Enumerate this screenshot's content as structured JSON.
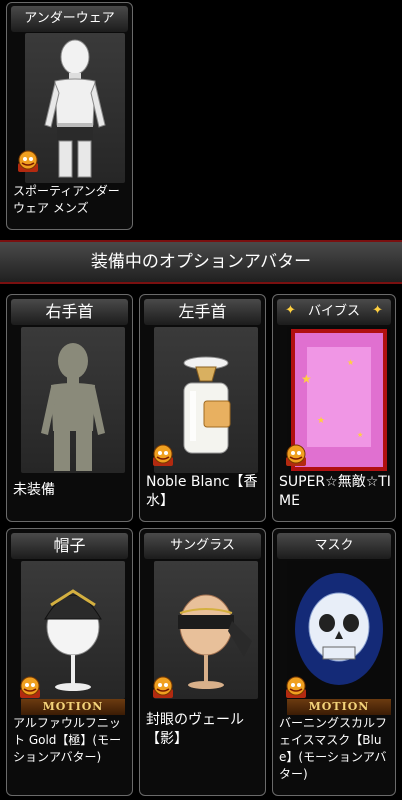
{
  "top_slot": {
    "header": "アンダーウェア",
    "item": "スポーティアンダーウェア メンズ"
  },
  "section": {
    "title": "装備中のオプションアバター"
  },
  "slots": [
    {
      "header": "右手首",
      "item": "未装備"
    },
    {
      "header": "左手首",
      "item": "Noble Blanc【香水】"
    },
    {
      "header": "バイブス",
      "item": "SUPER☆無敵☆TIME"
    },
    {
      "header": "帽子",
      "item": "アルファウルフニット Gold【極】(モーションアバター)",
      "tag": "MOTION"
    },
    {
      "header": "サングラス",
      "item": "封眼のヴェール【影】"
    },
    {
      "header": "マスク",
      "item": "バーニングスカルフェイスマスク【Blue】(モーションアバター)",
      "tag": "MOTION"
    }
  ]
}
